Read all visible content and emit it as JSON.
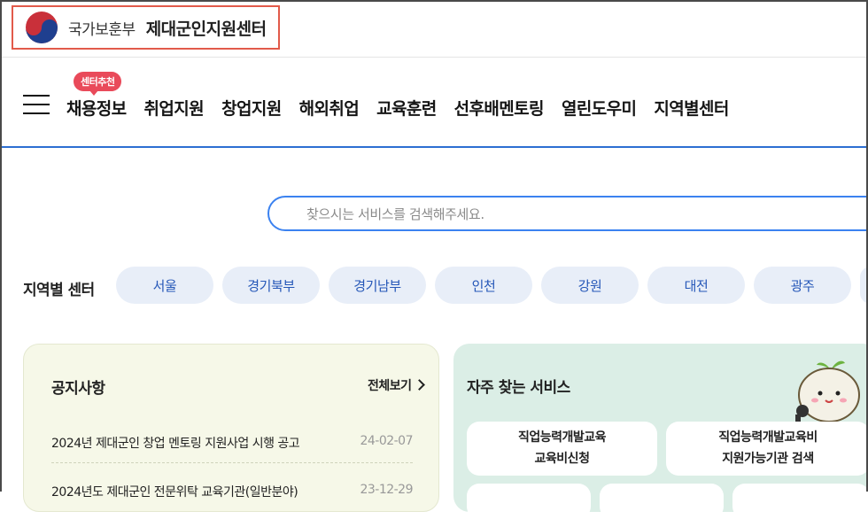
{
  "header": {
    "org_name": "국가보훈부",
    "center_name": "제대군인지원센터"
  },
  "nav": {
    "badge": "센터추천",
    "items": [
      "채용정보",
      "취업지원",
      "창업지원",
      "해외취업",
      "교육훈련",
      "선후배멘토링",
      "열린도우미",
      "지역별센터"
    ]
  },
  "search": {
    "placeholder": "찾으시는 서비스를 검색해주세요."
  },
  "region": {
    "label": "지역별 센터",
    "items": [
      "서울",
      "경기북부",
      "경기남부",
      "인천",
      "강원",
      "대전",
      "광주"
    ]
  },
  "notice": {
    "title": "공지사항",
    "more_label": "전체보기",
    "rows": [
      {
        "title": "2024년 제대군인 창업 멘토링 지원사업 시행 공고",
        "date": "24-02-07"
      },
      {
        "title": "2024년도 제대군인 전문위탁 교육기관(일반분야)",
        "date": "23-12-29"
      }
    ]
  },
  "services": {
    "title": "자주 찾는 서비스",
    "cards": [
      {
        "line1": "직업능력개발교육",
        "line2": "교육비신청"
      },
      {
        "line1": "직업능력개발교육비",
        "line2": "지원가능기관 검색"
      }
    ]
  },
  "colors": {
    "accent_blue": "#2d6fd2",
    "logo_highlight": "#e25a4a",
    "badge_red": "#e94a5a",
    "pill_bg": "#e8eef8",
    "notice_bg": "#f6f8e8",
    "services_bg": "#dbeee6"
  },
  "icons": [
    "taegeuk-logo-icon",
    "hamburger-menu-icon",
    "chevron-right-icon",
    "mascot-character-icon"
  ]
}
